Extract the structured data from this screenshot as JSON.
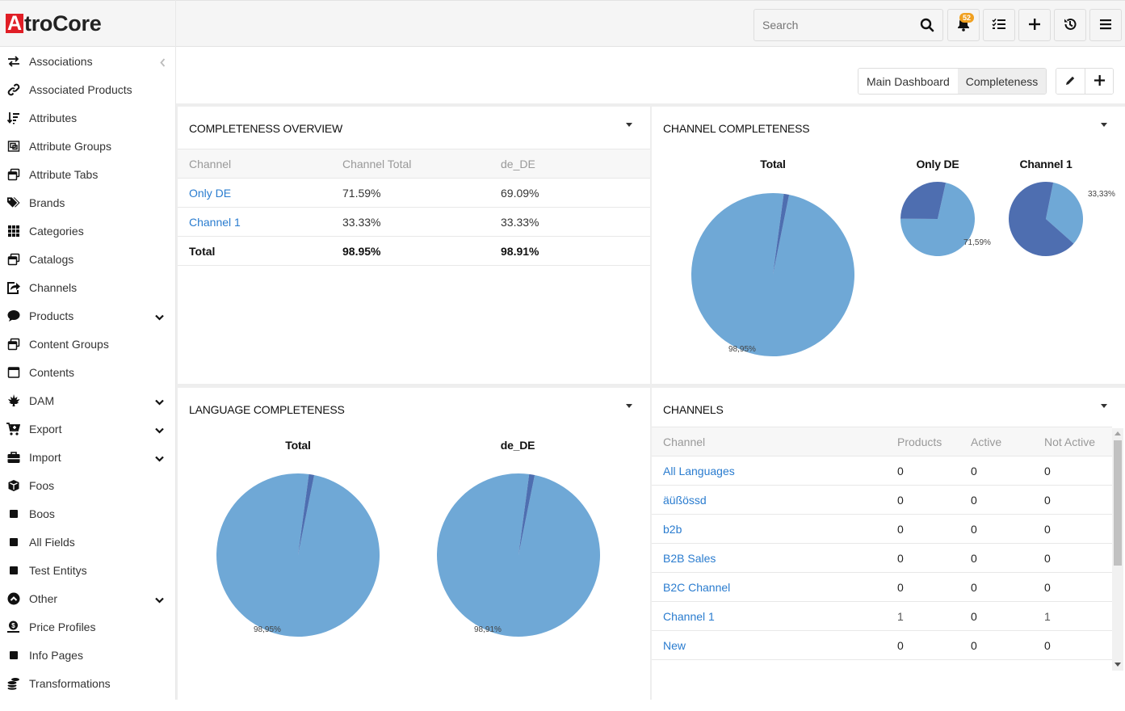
{
  "app": {
    "logo_a": "A",
    "logo_rest": "troCore"
  },
  "sidebar": {
    "items": [
      {
        "label": "Associations",
        "icon": "arrows-exchange-icon",
        "chevron": "left"
      },
      {
        "label": "Associated Products",
        "icon": "link-icon",
        "chevron": ""
      },
      {
        "label": "Attributes",
        "icon": "sort-list-icon",
        "chevron": ""
      },
      {
        "label": "Attribute Groups",
        "icon": "object-group-icon",
        "chevron": ""
      },
      {
        "label": "Attribute Tabs",
        "icon": "window-restore-icon",
        "chevron": ""
      },
      {
        "label": "Brands",
        "icon": "tags-icon",
        "chevron": ""
      },
      {
        "label": "Categories",
        "icon": "grid-icon",
        "chevron": ""
      },
      {
        "label": "Catalogs",
        "icon": "window-restore-icon",
        "chevron": ""
      },
      {
        "label": "Channels",
        "icon": "share-square-icon",
        "chevron": ""
      },
      {
        "label": "Products",
        "icon": "comment-icon",
        "chevron": "down"
      },
      {
        "label": "Content Groups",
        "icon": "window-restore-icon",
        "chevron": ""
      },
      {
        "label": "Contents",
        "icon": "window-maximize-icon",
        "chevron": ""
      },
      {
        "label": "DAM",
        "icon": "leaf-icon",
        "chevron": "down"
      },
      {
        "label": "Export",
        "icon": "cart-plus-icon",
        "chevron": "down"
      },
      {
        "label": "Import",
        "icon": "briefcase-icon",
        "chevron": "down"
      },
      {
        "label": "Foos",
        "icon": "cube-icon",
        "chevron": ""
      },
      {
        "label": "Boos",
        "icon": "square-icon",
        "chevron": ""
      },
      {
        "label": "All Fields",
        "icon": "square-icon",
        "chevron": ""
      },
      {
        "label": "Test Entitys",
        "icon": "square-icon",
        "chevron": ""
      },
      {
        "label": "Other",
        "icon": "chevron-circle-up-icon",
        "chevron": "down"
      },
      {
        "label": "Price Profiles",
        "icon": "money-check-icon",
        "chevron": ""
      },
      {
        "label": "Info Pages",
        "icon": "square-icon",
        "chevron": ""
      },
      {
        "label": "Transformations",
        "icon": "coins-icon",
        "chevron": ""
      }
    ]
  },
  "topbar": {
    "search_placeholder": "Search",
    "notification_count": "52",
    "buttons": [
      "search-icon",
      "bell-icon",
      "tasks-icon",
      "plus-icon",
      "history-icon",
      "menu-icon"
    ]
  },
  "dashboard": {
    "tabs": [
      {
        "label": "Main Dashboard",
        "active": false
      },
      {
        "label": "Completeness",
        "active": true
      }
    ]
  },
  "colors": {
    "accent_link": "#2a7ccf",
    "pie_complete": "#6fa8d6",
    "pie_incomplete": "#4e6eb0",
    "badge": "#f0a020",
    "logo_red": "#e01e26"
  },
  "completeness_overview": {
    "title": "Completeness Overview",
    "headers": [
      "Channel",
      "Channel Total",
      "de_DE"
    ],
    "rows": [
      {
        "channel": "Only DE",
        "total": "71.59%",
        "de_DE": "69.09%",
        "link": true
      },
      {
        "channel": "Channel 1",
        "total": "33.33%",
        "de_DE": "33.33%",
        "link": true
      },
      {
        "channel": "Total",
        "total": "98.95%",
        "de_DE": "98.91%",
        "link": false
      }
    ]
  },
  "channels": {
    "title": "Channels",
    "headers": [
      "Channel",
      "Products",
      "Active",
      "Not Active"
    ],
    "rows": [
      {
        "name": "All Languages",
        "products": "0",
        "active": "0",
        "not_active": "0"
      },
      {
        "name": "äüßössd",
        "products": "0",
        "active": "0",
        "not_active": "0"
      },
      {
        "name": "b2b",
        "products": "0",
        "active": "0",
        "not_active": "0"
      },
      {
        "name": "B2B Sales",
        "products": "0",
        "active": "0",
        "not_active": "0"
      },
      {
        "name": "B2C Channel",
        "products": "0",
        "active": "0",
        "not_active": "0"
      },
      {
        "name": "Channel 1",
        "products": "1",
        "active": "0",
        "not_active": "1"
      },
      {
        "name": "New",
        "products": "0",
        "active": "0",
        "not_active": "0"
      }
    ]
  },
  "chart_data": [
    {
      "type": "pie",
      "panel": "Channel Completeness",
      "title": "Total",
      "slices": [
        {
          "name": "complete",
          "value": 98.95,
          "label": "98,95%"
        },
        {
          "name": "incomplete",
          "value": 1.05,
          "label": ""
        }
      ]
    },
    {
      "type": "pie",
      "panel": "Channel Completeness",
      "title": "Only DE",
      "slices": [
        {
          "name": "complete",
          "value": 71.59,
          "label": "71,59%"
        },
        {
          "name": "incomplete",
          "value": 28.41,
          "label": ""
        }
      ]
    },
    {
      "type": "pie",
      "panel": "Channel Completeness",
      "title": "Channel 1",
      "slices": [
        {
          "name": "complete",
          "value": 33.33,
          "label": "33,33%"
        },
        {
          "name": "incomplete",
          "value": 66.67,
          "label": ""
        }
      ]
    },
    {
      "type": "pie",
      "panel": "Language Completeness",
      "title": "Total",
      "slices": [
        {
          "name": "complete",
          "value": 98.95,
          "label": "98,95%"
        },
        {
          "name": "incomplete",
          "value": 1.05,
          "label": ""
        }
      ]
    },
    {
      "type": "pie",
      "panel": "Language Completeness",
      "title": "de_DE",
      "slices": [
        {
          "name": "complete",
          "value": 98.91,
          "label": "98,91%"
        },
        {
          "name": "incomplete",
          "value": 1.09,
          "label": ""
        }
      ]
    }
  ],
  "panels": {
    "channel_completeness_title": "Channel Completeness",
    "language_completeness_title": "Language Completeness"
  }
}
